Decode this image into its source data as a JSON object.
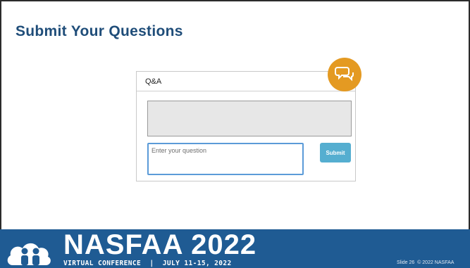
{
  "slide": {
    "title": "Submit Your Questions"
  },
  "qa_panel": {
    "label": "Q&A",
    "input_placeholder": "Enter your question",
    "submit_label": "Submit",
    "badge_icon": "chat-bubbles-icon"
  },
  "footer": {
    "brand": "NASFAA 2022",
    "subtitle": "VIRTUAL CONFERENCE  |  JULY 11-15, 2022",
    "slide_number": "Slide 26",
    "copyright": "© 2022 NASFAA",
    "logo_icon": "people-cloud-logo-icon"
  },
  "colors": {
    "title": "#1f4d79",
    "footer_bg": "#1f5b93",
    "submit_bg": "#55aed0",
    "badge_bg": "#e49a22",
    "input_border": "#5b9bd8"
  }
}
